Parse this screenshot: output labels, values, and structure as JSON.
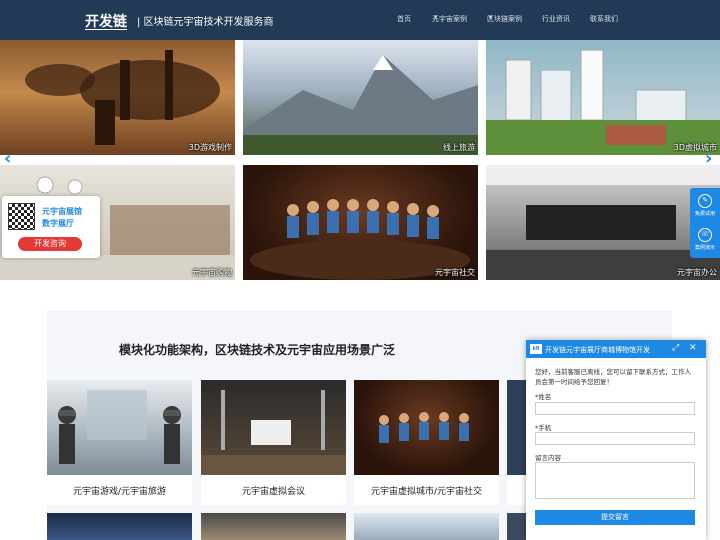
{
  "header": {
    "logo": "开发链",
    "tagline": "| 区块链元宇宙技术开发服务商",
    "nav": [
      "首页",
      "元宇宙案例",
      "区块链案例",
      "行业资讯",
      "联系我们"
    ]
  },
  "gallery": {
    "tiles": [
      "3D游戏制作",
      "线上旅游",
      "3D虚拟城市",
      "元宇宙购物",
      "元宇宙社交",
      "元宇宙办公"
    ],
    "prev_arrow": "‹",
    "next_arrow": "›"
  },
  "qr_card": {
    "line1": "元宇宙展馆",
    "line2": "数字展厅",
    "button": "开发咨询"
  },
  "side_float": {
    "item1": "免费试用",
    "item2": "案例演示"
  },
  "section": {
    "title": "模块化功能架构，区块链技术及元宇宙应用场景广泛",
    "cards": [
      "元宇宙游戏/元宇宙旅游",
      "元宇宙虚拟会议",
      "元宇宙虚拟城市/元宇宙社交"
    ]
  },
  "chat": {
    "logo": "kfl",
    "title": "开发链元宇宙展厅商城博物馆开发",
    "message": "您好，当前客服已离线，您可以留下联系方式，工作人员会第一时间给予您回复！",
    "name_label": "*姓名",
    "phone_label": "*手机",
    "message_label": "留言内容",
    "submit": "提交留言"
  },
  "colors": {
    "header_bg": "#223a55",
    "accent": "#1e88e5",
    "cta_red": "#e53935"
  }
}
